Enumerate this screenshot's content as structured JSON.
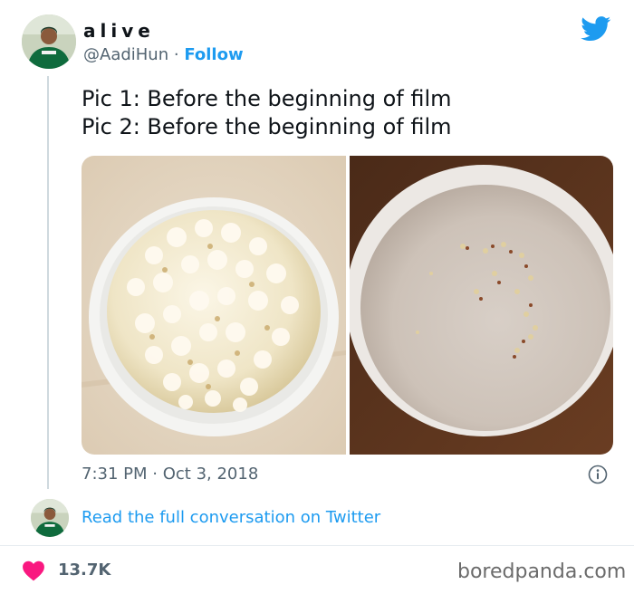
{
  "author": {
    "display_name": "alive",
    "handle": "@AadiHun",
    "separator": "·",
    "follow_label": "Follow"
  },
  "tweet": {
    "lines": [
      "Pic 1: Before the beginning of film",
      "Pic 2: Before the beginning of film"
    ],
    "time": "7:31 PM",
    "date_separator": "·",
    "date": "Oct 3, 2018"
  },
  "footer": {
    "read_link": "Read the full conversation on Twitter",
    "likes": "13.7K",
    "watermark": "boredpanda.com"
  },
  "icons": {
    "brand": "twitter-bird-icon",
    "info": "info-icon",
    "like": "heart-icon"
  },
  "colors": {
    "accent": "#1d9bf0",
    "heart": "#f91880",
    "muted": "#536471"
  }
}
